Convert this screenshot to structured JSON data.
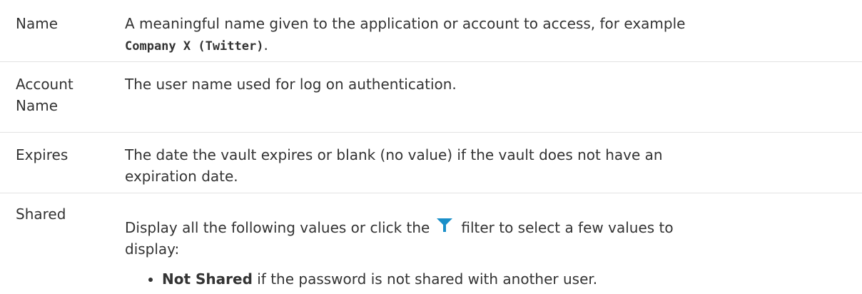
{
  "rows": [
    {
      "term": "Name",
      "desc_text": "A meaningful name given to the application or account to access, for example",
      "desc_code": "Company X (Twitter)",
      "desc_after": "."
    },
    {
      "term_line1": "Account",
      "term_line2": "Name",
      "desc": "The user name used for log on authentication."
    },
    {
      "term": "Expires",
      "desc_line1": "The date the vault expires or blank (no value) if the vault does not have an",
      "desc_line2": "expiration date."
    },
    {
      "term": "Shared",
      "desc_before": "Display all the following values or click the",
      "desc_after": "filter to select a few values to",
      "desc_line2": "display:",
      "icon": "filter-icon",
      "icon_color": "#1a8fc9",
      "list_items": [
        {
          "bold": "Not Shared",
          "text": " if the password is not shared with another user."
        }
      ]
    }
  ]
}
